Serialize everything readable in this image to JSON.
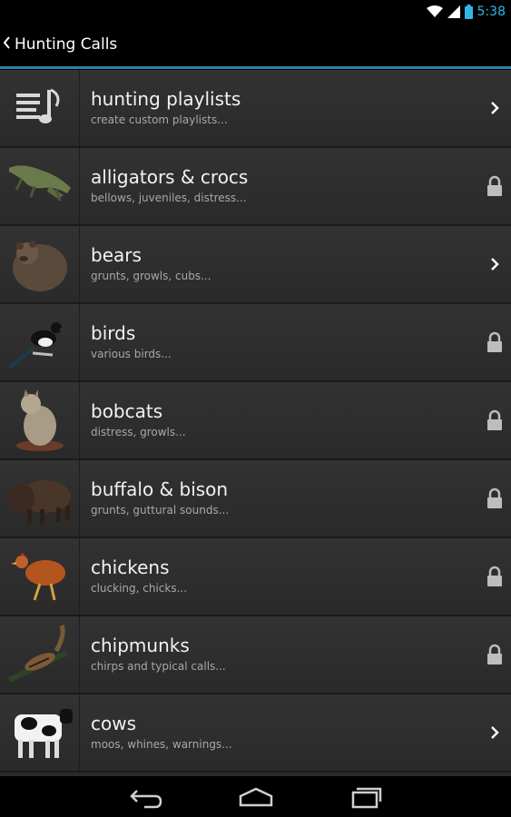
{
  "status_bar": {
    "time": "5:38",
    "icons": [
      "wifi-icon",
      "signal-icon",
      "battery-icon"
    ]
  },
  "action_bar": {
    "title": "Hunting Calls",
    "icon": "back-caret-icon"
  },
  "items": [
    {
      "title": "hunting playlists",
      "subtitle": "create custom playlists...",
      "icon": "playlist-icon",
      "indicator": "chevron-right-icon"
    },
    {
      "title": "alligators & crocs",
      "subtitle": "bellows, juveniles, distress...",
      "icon": "alligator-thumbnail",
      "indicator": "lock-icon"
    },
    {
      "title": "bears",
      "subtitle": "grunts, growls, cubs...",
      "icon": "bear-thumbnail",
      "indicator": "chevron-right-icon"
    },
    {
      "title": "birds",
      "subtitle": "various birds...",
      "icon": "magpie-thumbnail",
      "indicator": "lock-icon"
    },
    {
      "title": "bobcats",
      "subtitle": "distress, growls...",
      "icon": "bobcat-thumbnail",
      "indicator": "lock-icon"
    },
    {
      "title": "buffalo & bison",
      "subtitle": "grunts, guttural sounds...",
      "icon": "bison-thumbnail",
      "indicator": "lock-icon"
    },
    {
      "title": "chickens",
      "subtitle": "clucking, chicks...",
      "icon": "chicken-thumbnail",
      "indicator": "lock-icon"
    },
    {
      "title": "chipmunks",
      "subtitle": "chirps and typical calls...",
      "icon": "chipmunk-thumbnail",
      "indicator": "lock-icon"
    },
    {
      "title": "cows",
      "subtitle": "moos, whines, warnings...",
      "icon": "cow-thumbnail",
      "indicator": "chevron-right-icon"
    }
  ],
  "nav_bar": {
    "buttons": [
      "back-nav-icon",
      "home-nav-icon",
      "recent-apps-icon"
    ]
  },
  "colors": {
    "accent": "#33b5e5",
    "divider_accent": "#2f7fa6",
    "row_bg": "#2f2f2f",
    "subtitle": "#a8a8a8"
  }
}
